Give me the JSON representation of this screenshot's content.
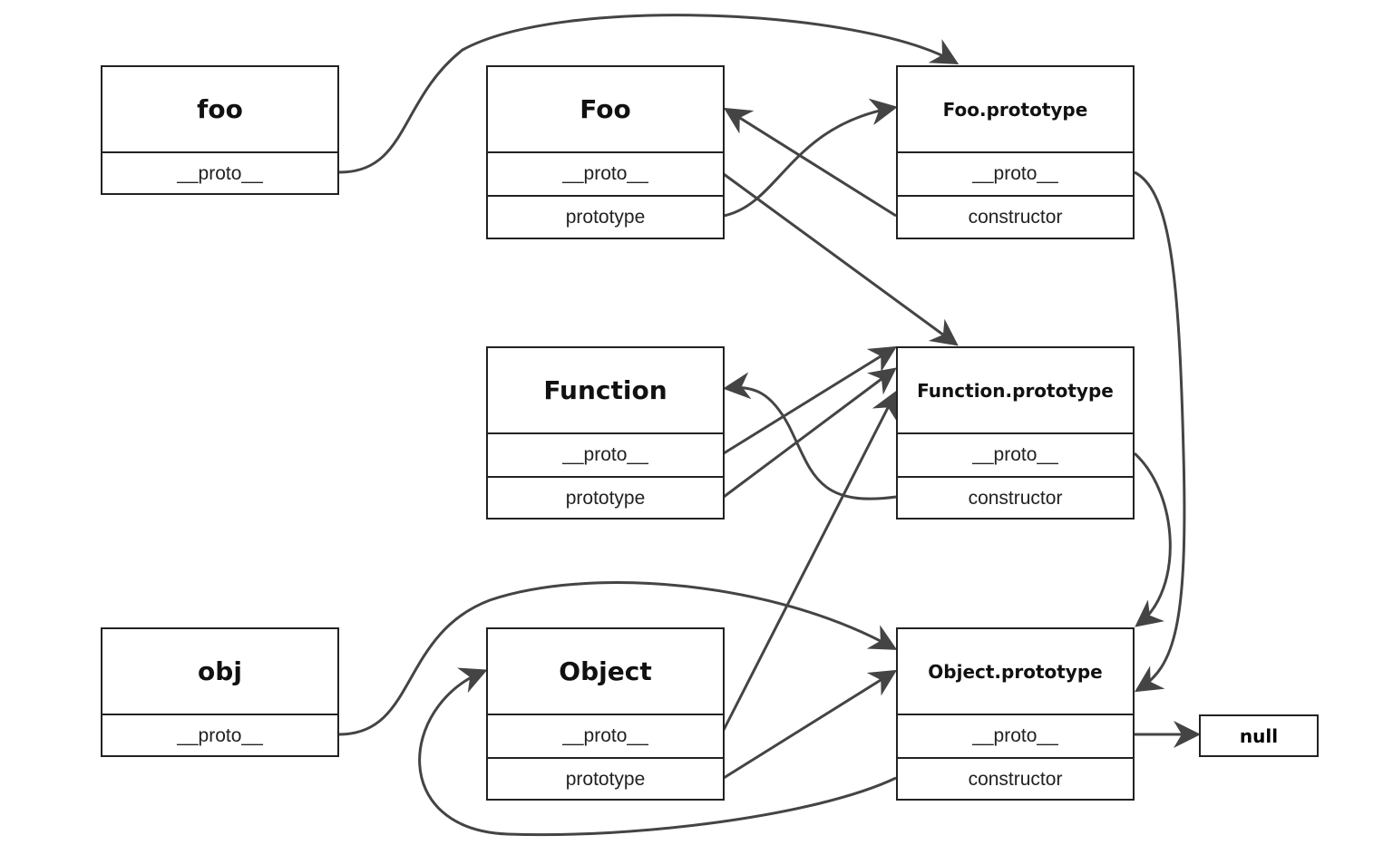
{
  "nodes": {
    "foo": {
      "title": "foo",
      "rows": [
        "__proto__"
      ]
    },
    "Foo": {
      "title": "Foo",
      "rows": [
        "__proto__",
        "prototype"
      ]
    },
    "FooPrototype": {
      "title": "Foo.prototype",
      "rows": [
        "__proto__",
        "constructor"
      ]
    },
    "Function": {
      "title": "Function",
      "rows": [
        "__proto__",
        "prototype"
      ]
    },
    "FunctionPrototype": {
      "title": "Function.prototype",
      "rows": [
        "__proto__",
        "constructor"
      ]
    },
    "obj": {
      "title": "obj",
      "rows": [
        "__proto__"
      ]
    },
    "Object": {
      "title": "Object",
      "rows": [
        "__proto__",
        "prototype"
      ]
    },
    "ObjectPrototype": {
      "title": "Object.prototype",
      "rows": [
        "__proto__",
        "constructor"
      ]
    },
    "null": {
      "title": "null"
    }
  },
  "colors": {
    "arrow": "#444444",
    "border": "#222222"
  }
}
